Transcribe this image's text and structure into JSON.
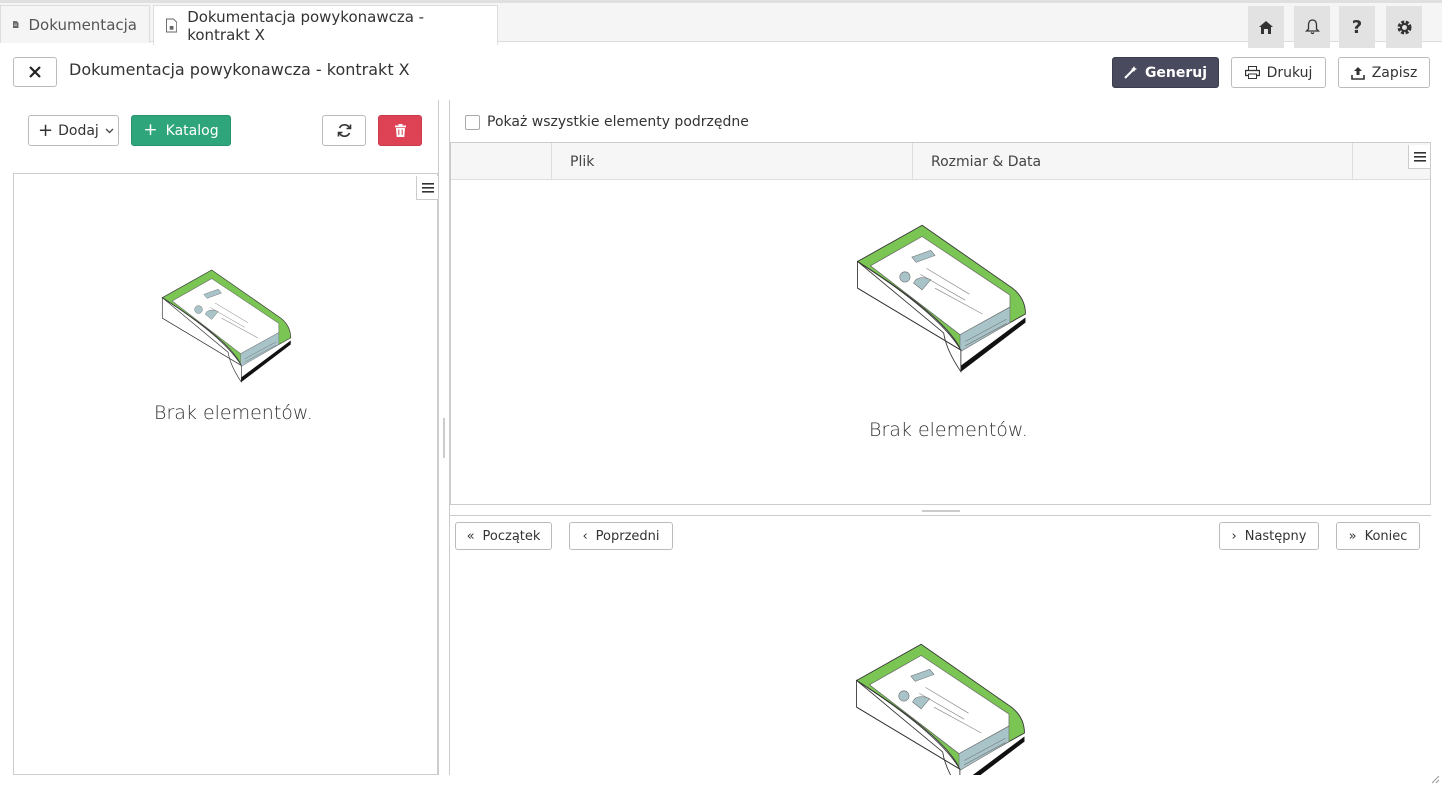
{
  "tabs": [
    {
      "label": "Dokumentacja",
      "icon": "document-icon"
    },
    {
      "label": "Dokumentacja powykonawcza - kontrakt X",
      "icon": "document-lock-icon"
    }
  ],
  "toolbar": {
    "home": "home-icon",
    "bell": "bell-icon",
    "help": "question-icon",
    "settings": "gear-icon"
  },
  "header": {
    "title": "Dokumentacja powykonawcza - kontrakt X",
    "generate_label": "Generuj",
    "print_label": "Drukuj",
    "save_label": "Zapisz"
  },
  "left": {
    "add_label": "Dodaj",
    "catalog_label": "Katalog",
    "empty_text": "Brak elementów."
  },
  "right": {
    "checkbox_label": "Pokaż wszystkie elementy podrzędne",
    "columns": [
      "Plik",
      "Rozmiar & Data"
    ],
    "empty_text": "Brak elementów.",
    "pager": {
      "first": "Początek",
      "prev": "Poprzedni",
      "next": "Następny",
      "last": "Koniec"
    }
  },
  "colors": {
    "accent_green": "#2fa57c",
    "danger": "#dd4255",
    "dark_button": "#4a4a5e"
  }
}
